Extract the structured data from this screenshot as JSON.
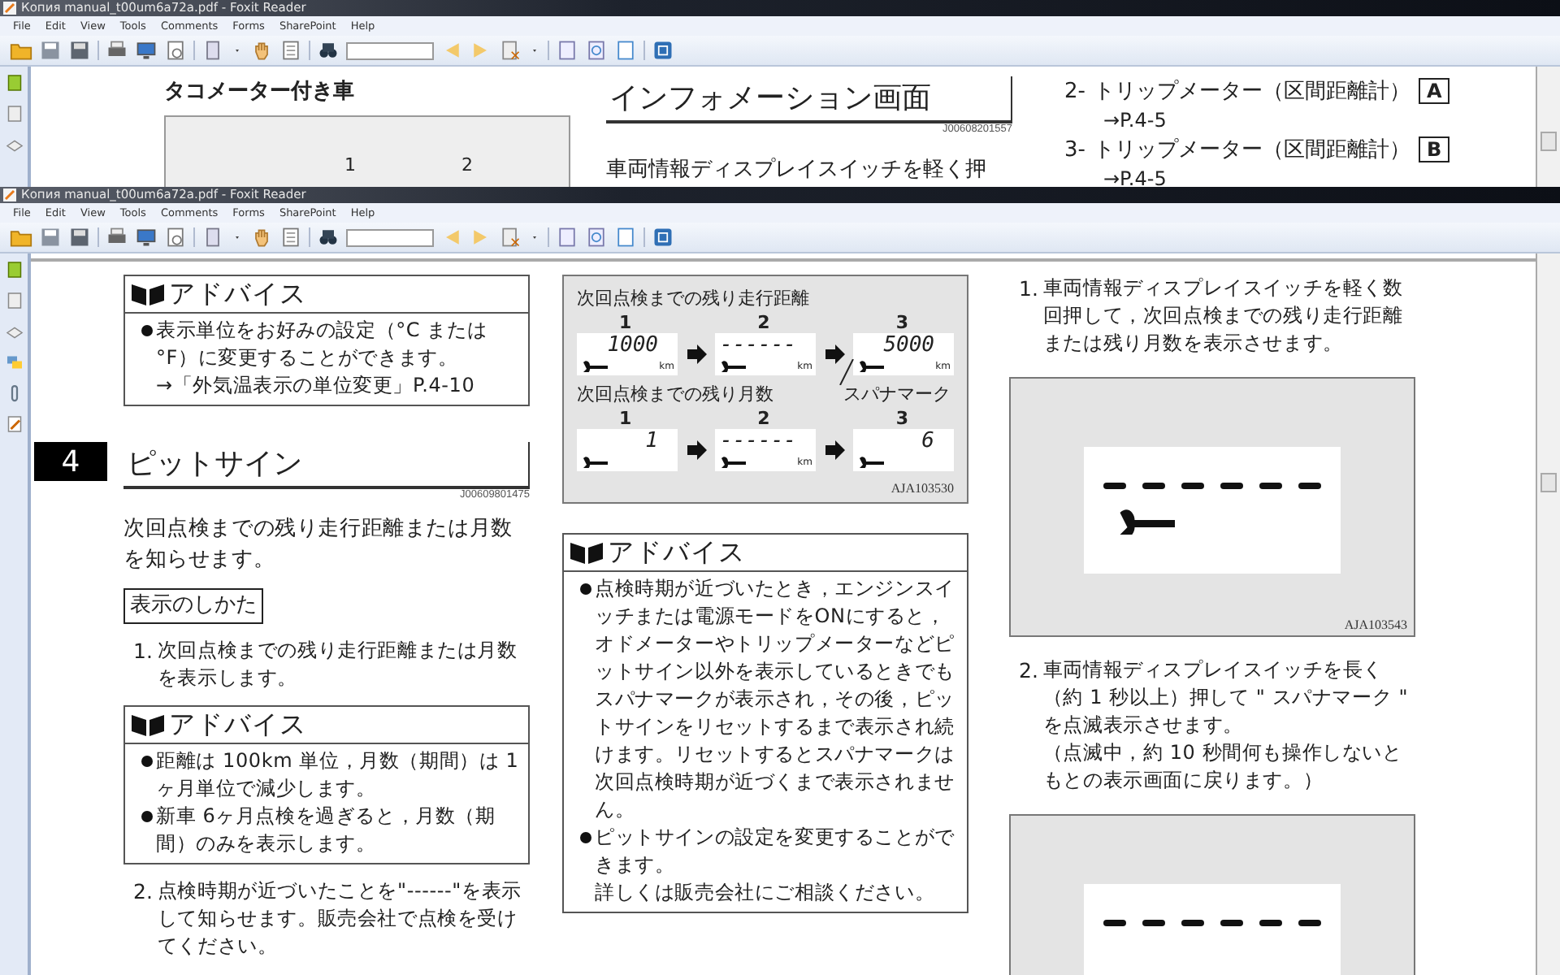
{
  "back_window": {
    "title": "Копия manual_t00um6a72a.pdf - Foxit Reader",
    "menu": [
      "File",
      "Edit",
      "View",
      "Tools",
      "Comments",
      "Forms",
      "SharePoint",
      "Help"
    ],
    "page": {
      "left": {
        "heading": "タコメーター付き車",
        "figure_labels": [
          "1",
          "2"
        ]
      },
      "middle": {
        "heading": "インフォメーション画面",
        "code": "J00608201557",
        "text": "車両情報ディスプレイスイッチを軽く押"
      },
      "right": [
        {
          "number": "2-",
          "text": "トリップメーター（区間距離計）",
          "key": "A",
          "ref": "→P.4-5"
        },
        {
          "number": "3-",
          "text": "トリップメーター（区間距離計）",
          "key": "B",
          "ref": "→P.4-5"
        }
      ]
    }
  },
  "front_window": {
    "title": "Копия manual_t00um6a72a.pdf - Foxit Reader",
    "menu": [
      "File",
      "Edit",
      "View",
      "Tools",
      "Comments",
      "Forms",
      "SharePoint",
      "Help"
    ],
    "columns": [
      [
        {
          "kind": "advice",
          "title": "アドバイス",
          "bullets": [
            {
              "text": "表示単位をお好みの設定（°C または °F）に変更することができます。",
              "note": "→「外気温表示の単位変更」P.4-10"
            }
          ]
        },
        {
          "kind": "heading",
          "chapter": "4",
          "title": "ピットサイン",
          "code": "J00609801475"
        },
        {
          "kind": "paragraph",
          "text": "次回点検までの残り走行距離または月数を知らせます。"
        },
        {
          "kind": "label",
          "text": "表示のしかた"
        },
        {
          "kind": "step",
          "number": "1.",
          "text": "次回点検までの残り走行距離または月数を表示します。"
        },
        {
          "kind": "advice",
          "title": "アドバイス",
          "bullets": [
            {
              "text": "距離は 100km 単位，月数（期間）は 1ヶ月単位で減少します。"
            },
            {
              "text": "新車 6ヶ月点検を過ぎると，月数（期間）のみを表示します。"
            }
          ]
        },
        {
          "kind": "step",
          "number": "2.",
          "text": "点検時期が近づいたことを\"------\"を表示して知らせます。販売会社で点検を受けてください。"
        }
      ],
      [
        {
          "kind": "meter-figure",
          "code": "AJA103530",
          "groups": [
            {
              "caption": "次回点検までの残り走行距離",
              "displays": [
                {
                  "number": "1",
                  "value": "1000",
                  "unit": "km"
                },
                {
                  "number": "2",
                  "value": "------",
                  "unit": "km"
                },
                {
                  "number": "3",
                  "value": "5000",
                  "unit": "km"
                }
              ]
            },
            {
              "caption": "次回点検までの残り月数",
              "callout": "スパナマーク",
              "displays": [
                {
                  "number": "1",
                  "value": "1"
                },
                {
                  "number": "2",
                  "value": "------",
                  "unit": "km"
                },
                {
                  "number": "3",
                  "value": "6"
                }
              ]
            }
          ]
        },
        {
          "kind": "advice",
          "title": "アドバイス",
          "bullets": [
            {
              "text": "点検時期が近づいたとき，エンジンスイッチまたは電源モードをONにすると，オドメーターやトリップメーターなどピットサイン以外を表示しているときでもスパナマークが表示され，その後，ピットサインをリセットするまで表示され続けます。リセットするとスパナマークは次回点検時期が近づくまで表示されません。"
            },
            {
              "text": "ピットサインの設定を変更することができます。",
              "note": "詳しくは販売会社にご相談ください。"
            }
          ]
        }
      ],
      [
        {
          "kind": "step",
          "number": "1.",
          "text": "車両情報ディスプレイスイッチを軽く数回押して，次回点検までの残り走行距離または残り月数を表示させます。"
        },
        {
          "kind": "display-figure",
          "code": "AJA103543"
        },
        {
          "kind": "step",
          "number": "2.",
          "text": "車両情報ディスプレイスイッチを長く（約 1 秒以上）押して \" スパナマーク \" を点滅表示させます。",
          "note": "（点滅中，約 10 秒間何も操作しないともとの表示画面に戻ります。）"
        },
        {
          "kind": "display-figure"
        }
      ]
    ]
  }
}
